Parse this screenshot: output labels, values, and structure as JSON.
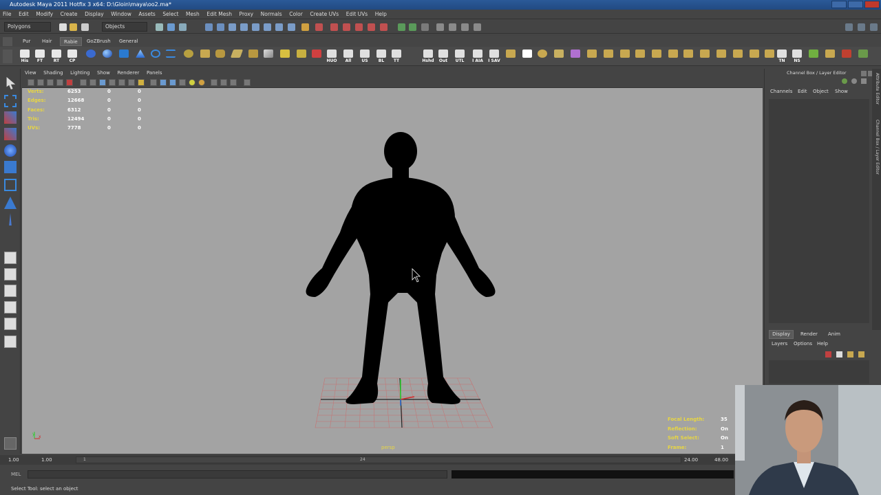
{
  "window": {
    "title": "Autodesk Maya 2011 Hotfix 3 x64: D:\\Gloin\\maya\\oo2.ma*"
  },
  "menubar": [
    "File",
    "Edit",
    "Modify",
    "Create",
    "Display",
    "Window",
    "Assets",
    "Select",
    "Mesh",
    "Edit Mesh",
    "Proxy",
    "Normals",
    "Color",
    "Create UVs",
    "Edit UVs",
    "Help"
  ],
  "statusline": {
    "menuset": "Polygons",
    "selection_mode": "Objects"
  },
  "shelf": {
    "tabs": [
      "Pur",
      "Hair",
      "Rabie",
      "GoZBrush",
      "General"
    ],
    "active_tab": "Rabie",
    "labeled_icons": [
      "His",
      "FT",
      "RT",
      "CP",
      "HUO",
      "All",
      "US",
      "BL",
      "TT",
      "Hshd",
      "Out",
      "UTL",
      "I AIA",
      "I SAV"
    ],
    "right_icons": [
      "TN",
      "NS"
    ]
  },
  "panel": {
    "menu": [
      "View",
      "Shading",
      "Lighting",
      "Show",
      "Renderer",
      "Panels"
    ]
  },
  "hud_poly_count": [
    {
      "label": "Verts:",
      "value": "6253",
      "sel1": "0",
      "sel2": "0"
    },
    {
      "label": "Edges:",
      "value": "12668",
      "sel1": "0",
      "sel2": "0"
    },
    {
      "label": "Faces:",
      "value": "6312",
      "sel1": "0",
      "sel2": "0"
    },
    {
      "label": "Tris:",
      "value": "12494",
      "sel1": "0",
      "sel2": "0"
    },
    {
      "label": "UVs:",
      "value": "7778",
      "sel1": "0",
      "sel2": "0"
    }
  ],
  "hud_camera": [
    {
      "label": "Focal Length:",
      "value": "35"
    },
    {
      "label": "Reflection:",
      "value": "On"
    },
    {
      "label": "Soft Select:",
      "value": "On"
    },
    {
      "label": "Frame:",
      "value": "1"
    }
  ],
  "camera_name": "persp",
  "axis": {
    "x": "x",
    "y": "y"
  },
  "channelbox": {
    "title": "Channel Box / Layer Editor",
    "menu": [
      "Channels",
      "Edit",
      "Object",
      "Show"
    ],
    "side_tabs": [
      "Attribute Editor",
      "Channel Box / Layer Editor"
    ]
  },
  "layer_editor": {
    "tabs": [
      "Display",
      "Render",
      "Anim"
    ],
    "active_tab": "Display",
    "menu": [
      "Layers",
      "Options",
      "Help"
    ]
  },
  "timeline": {
    "start": "1.00",
    "playback_start": "1.00",
    "tick_start": "1",
    "tick_end": "24",
    "playback_end": "24.00",
    "end": "48.00"
  },
  "cmdline": {
    "lang": "MEL"
  },
  "helpline": "Select Tool: select an object",
  "colors": {
    "viewport_bg": "#a3a3a3",
    "hud_label": "#e8d642",
    "titlebar": "#2b5a98"
  }
}
